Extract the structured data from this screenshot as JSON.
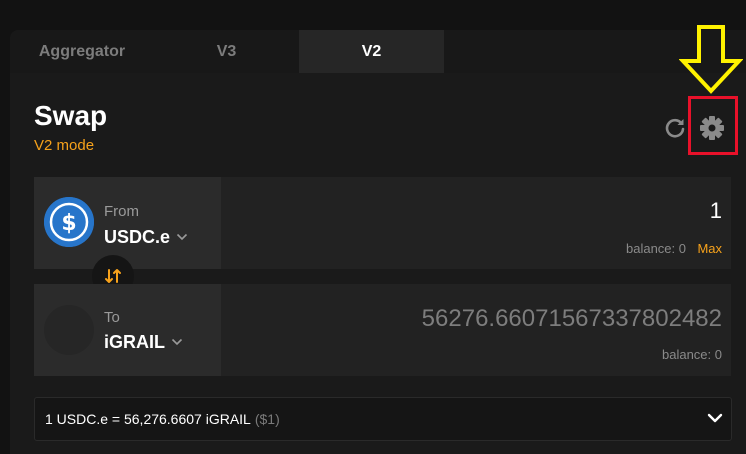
{
  "tabs": [
    {
      "label": "Aggregator",
      "active": false
    },
    {
      "label": "V3",
      "active": false
    },
    {
      "label": "V2",
      "active": true
    }
  ],
  "swap": {
    "title": "Swap",
    "mode": "V2 mode"
  },
  "icons": {
    "refresh": "refresh-icon",
    "settings": "gear-icon",
    "switch": "swap-arrows-icon",
    "chevron": "chevron-down-icon"
  },
  "from": {
    "label": "From",
    "token": "USDC.e",
    "amount": "1",
    "balance": "balance: 0",
    "max_label": "Max"
  },
  "to": {
    "label": "To",
    "token": "iGRAIL",
    "amount": "56276.66071567337802482",
    "balance": "balance: 0"
  },
  "rate": {
    "text": "1 USDC.e = 56,276.6607 iGRAIL",
    "usd": "($1)"
  },
  "colors": {
    "accent": "#f7a21b",
    "usdc": "#2775ca",
    "highlight": "#e8112a",
    "annotation_arrow": "#fff200"
  }
}
